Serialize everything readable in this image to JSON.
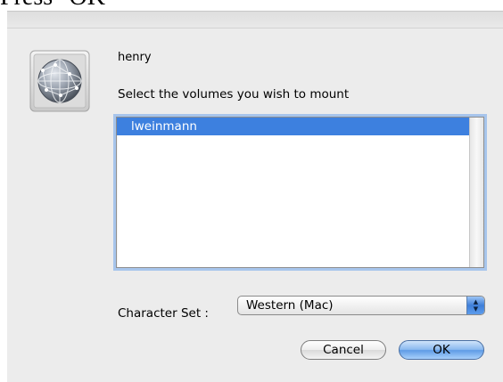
{
  "caption": {
    "text": "Press \"OK\""
  },
  "dialog": {
    "server_name": "henry",
    "prompt": "Select the volumes you wish to mount",
    "volumes": [
      {
        "name": "lweinmann",
        "selected": true
      }
    ],
    "character_set": {
      "label": "Character Set :",
      "value": "Western (Mac)"
    },
    "buttons": {
      "cancel": "Cancel",
      "ok": "OK"
    }
  },
  "icons": {
    "app_icon": "network-globe-icon",
    "popup_arrows": "up-down-arrows-icon"
  },
  "colors": {
    "selection": "#3d80df",
    "focus_ring": "#a7c5ec",
    "default_button": "#5e9be6"
  }
}
